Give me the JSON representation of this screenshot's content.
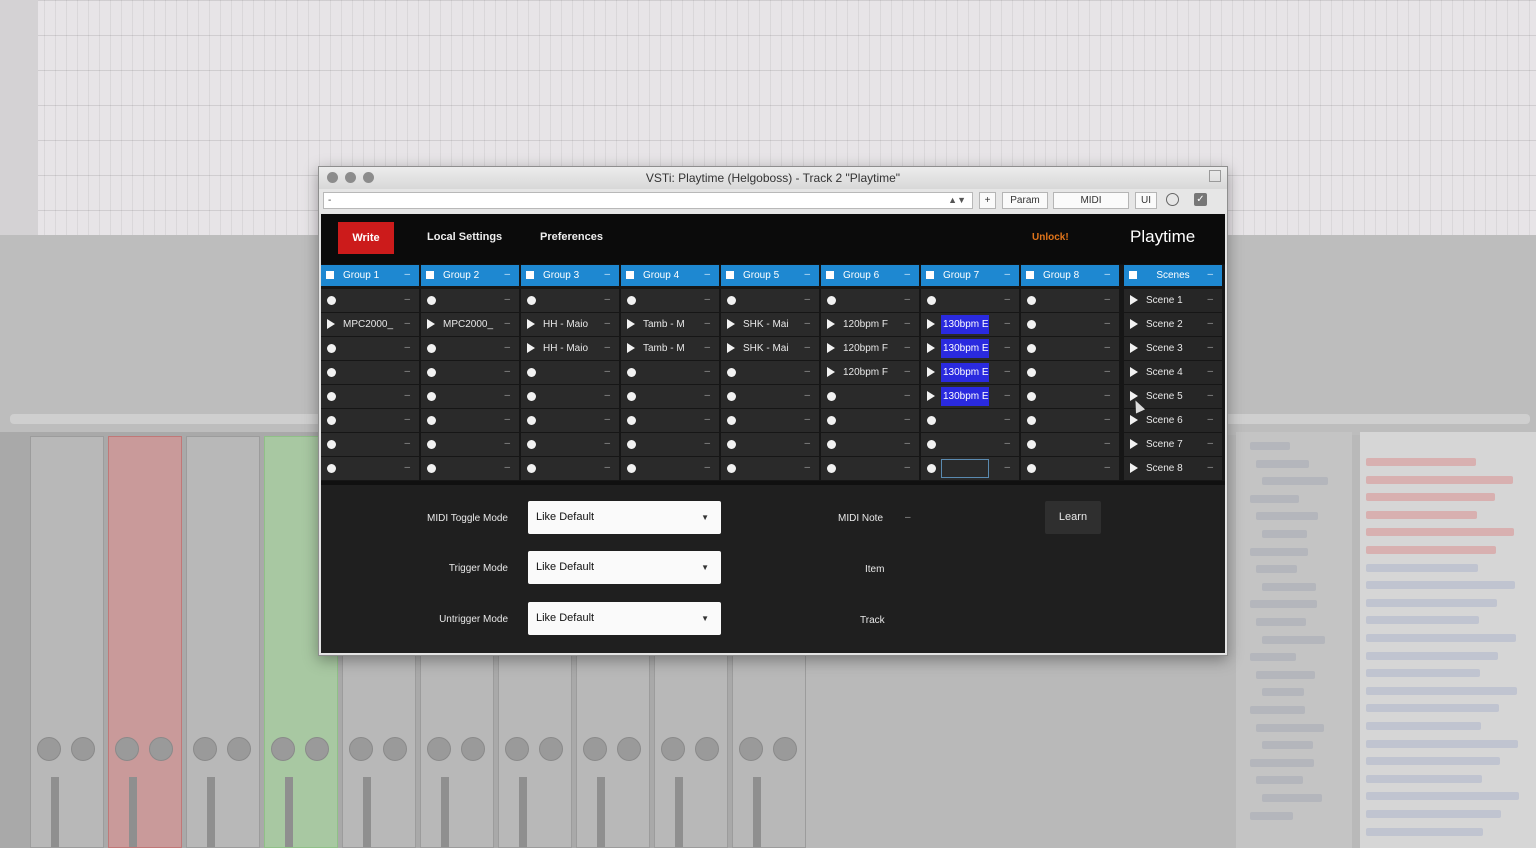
{
  "window": {
    "title": "VSTi: Playtime (Helgoboss) - Track 2 \"Playtime\"",
    "preset_value": "-",
    "toolbar": {
      "add": "+",
      "param": "Param",
      "midi": "MIDI",
      "ui": "UI",
      "enabled_check": "✓"
    }
  },
  "header": {
    "write": "Write",
    "local_settings": "Local Settings",
    "preferences": "Preferences",
    "unlock": "Unlock!",
    "logo": "Playtime"
  },
  "groups": [
    {
      "name": "Group 1",
      "menu": "–",
      "cells": [
        {
          "t": "dot"
        },
        {
          "t": "play",
          "label": "MPC2000_"
        },
        {
          "t": "dot"
        },
        {
          "t": "dot"
        },
        {
          "t": "dot"
        },
        {
          "t": "dot"
        },
        {
          "t": "dot"
        },
        {
          "t": "dot"
        }
      ]
    },
    {
      "name": "Group 2",
      "menu": "–",
      "cells": [
        {
          "t": "dot"
        },
        {
          "t": "play",
          "label": "MPC2000_"
        },
        {
          "t": "dot"
        },
        {
          "t": "dot"
        },
        {
          "t": "dot"
        },
        {
          "t": "dot"
        },
        {
          "t": "dot"
        },
        {
          "t": "dot"
        }
      ]
    },
    {
      "name": "Group 3",
      "menu": "–",
      "cells": [
        {
          "t": "dot"
        },
        {
          "t": "play",
          "label": "HH - Maio"
        },
        {
          "t": "play",
          "label": "HH - Maio"
        },
        {
          "t": "dot"
        },
        {
          "t": "dot"
        },
        {
          "t": "dot"
        },
        {
          "t": "dot"
        },
        {
          "t": "dot"
        }
      ]
    },
    {
      "name": "Group 4",
      "menu": "–",
      "cells": [
        {
          "t": "dot"
        },
        {
          "t": "play",
          "label": "Tamb - M"
        },
        {
          "t": "play",
          "label": "Tamb - M"
        },
        {
          "t": "dot"
        },
        {
          "t": "dot"
        },
        {
          "t": "dot"
        },
        {
          "t": "dot"
        },
        {
          "t": "dot"
        }
      ]
    },
    {
      "name": "Group 5",
      "menu": "–",
      "cells": [
        {
          "t": "dot"
        },
        {
          "t": "play",
          "label": "SHK - Mai"
        },
        {
          "t": "play",
          "label": "SHK - Mai"
        },
        {
          "t": "dot"
        },
        {
          "t": "dot"
        },
        {
          "t": "dot"
        },
        {
          "t": "dot"
        },
        {
          "t": "dot"
        }
      ]
    },
    {
      "name": "Group 6",
      "menu": "–",
      "cells": [
        {
          "t": "dot"
        },
        {
          "t": "play",
          "label": "120bpm F"
        },
        {
          "t": "play",
          "label": "120bpm F"
        },
        {
          "t": "play",
          "label": "120bpm F"
        },
        {
          "t": "dot"
        },
        {
          "t": "dot"
        },
        {
          "t": "dot"
        },
        {
          "t": "dot"
        }
      ]
    },
    {
      "name": "Group 7",
      "menu": "–",
      "cells": [
        {
          "t": "dot"
        },
        {
          "t": "play",
          "label": "130bpm E",
          "hl": true
        },
        {
          "t": "play",
          "label": "130bpm E",
          "hl": true
        },
        {
          "t": "play",
          "label": "130bpm E",
          "hl": true
        },
        {
          "t": "play",
          "label": "130bpm E",
          "hl": true
        },
        {
          "t": "dot"
        },
        {
          "t": "dot"
        },
        {
          "t": "dot",
          "sel": true
        }
      ]
    },
    {
      "name": "Group 8",
      "menu": "–",
      "cells": [
        {
          "t": "dot"
        },
        {
          "t": "dot"
        },
        {
          "t": "dot"
        },
        {
          "t": "dot"
        },
        {
          "t": "dot"
        },
        {
          "t": "dot"
        },
        {
          "t": "dot"
        },
        {
          "t": "dot"
        }
      ]
    }
  ],
  "scenes": {
    "header": "Scenes",
    "menu": "–",
    "items": [
      "Scene 1",
      "Scene 2",
      "Scene 3",
      "Scene 4",
      "Scene 5",
      "Scene 6",
      "Scene 7",
      "Scene 8"
    ]
  },
  "settings": {
    "midi_toggle_mode_label": "MIDI Toggle Mode",
    "midi_toggle_mode_value": "Like Default",
    "trigger_mode_label": "Trigger Mode",
    "trigger_mode_value": "Like Default",
    "untrigger_mode_label": "Untrigger Mode",
    "untrigger_mode_value": "Like Default",
    "midi_note_label": "MIDI Note",
    "midi_note_value": "–",
    "learn": "Learn",
    "item_label": "Item",
    "track_label": "Track"
  },
  "colors": {
    "accent_blue": "#1e88d1",
    "write_red": "#cc1b1b",
    "unlock_orange": "#e0741a",
    "clip_highlight": "#2a2adf"
  }
}
